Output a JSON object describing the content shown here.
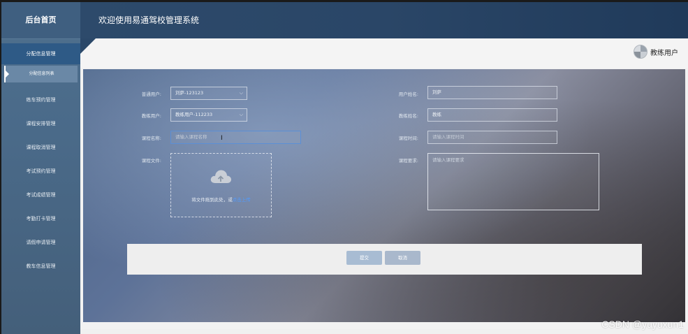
{
  "sidebar": {
    "title": "后台首页",
    "items": [
      {
        "label": "分配信息管理",
        "active": true
      },
      {
        "label": "分配信息列表",
        "sub": true,
        "selected": true
      },
      {
        "label": "练车预约管理"
      },
      {
        "label": "课程安排管理"
      },
      {
        "label": "课程取消管理"
      },
      {
        "label": "考试预约管理"
      },
      {
        "label": "考试成绩管理"
      },
      {
        "label": "考勤打卡管理"
      },
      {
        "label": "请假申请管理"
      },
      {
        "label": "教车信息管理"
      }
    ]
  },
  "header": {
    "title": "欢迎使用易通驾校管理系统"
  },
  "user": {
    "name": "教练用户"
  },
  "form": {
    "left": {
      "user_label": "普通用户:",
      "user_value": "刘萨-123123",
      "coach_label": "教练用户:",
      "coach_value": "教练用户-112233",
      "course_name_label": "课程名称:",
      "course_name_placeholder": "请输入课程名称",
      "course_file_label": "课程文件:",
      "upload_text": "将文件拖到此处，或",
      "upload_link": "点击上传"
    },
    "right": {
      "user_name_label": "用户姓名:",
      "user_name_value": "刘萨",
      "coach_name_label": "教练姓名:",
      "coach_name_value": "教练",
      "course_time_label": "课程时间:",
      "course_time_placeholder": "请输入课程时间",
      "course_req_label": "课程要求:",
      "course_req_placeholder": "请输入课程要求"
    },
    "buttons": {
      "submit": "提交",
      "cancel": "取消"
    }
  },
  "watermark": "CSDN @yuyuxun1",
  "colors": {
    "link": "#4f9bff",
    "header": "#2d4a6b",
    "sidebar": "#4e6f8e"
  }
}
